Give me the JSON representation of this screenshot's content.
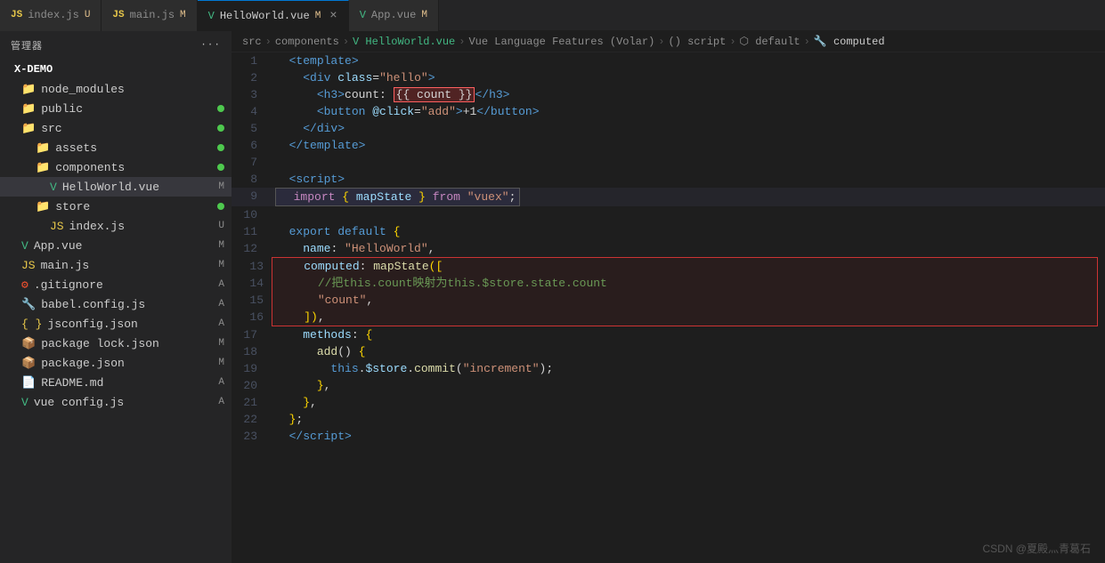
{
  "tabs": [
    {
      "id": "index",
      "label": "index.js",
      "type": "js",
      "badge": "U",
      "active": false
    },
    {
      "id": "main",
      "label": "main.js",
      "type": "js",
      "badge": "M",
      "active": false
    },
    {
      "id": "helloworld",
      "label": "HelloWorld.vue",
      "type": "vue",
      "badge": "M",
      "active": true
    },
    {
      "id": "appvue",
      "label": "App.vue",
      "type": "vue",
      "badge": "M",
      "active": false
    }
  ],
  "breadcrumb": {
    "items": [
      "src",
      "components",
      "HelloWorld.vue",
      "Vue Language Features (Volar)",
      "() script",
      "default",
      "computed"
    ]
  },
  "sidebar": {
    "header": "管理器",
    "project": "X-DEMO",
    "items": [
      {
        "name": "node_modules",
        "type": "folder",
        "badge": "",
        "dot": false,
        "indent": 1
      },
      {
        "name": "public",
        "type": "folder",
        "badge": "",
        "dot": true,
        "dotColor": "green",
        "indent": 1
      },
      {
        "name": "src",
        "type": "folder",
        "badge": "",
        "dot": true,
        "dotColor": "green",
        "indent": 1
      },
      {
        "name": "assets",
        "type": "folder",
        "badge": "",
        "dot": true,
        "dotColor": "green",
        "indent": 2
      },
      {
        "name": "components",
        "type": "folder",
        "badge": "",
        "dot": true,
        "dotColor": "green",
        "indent": 2
      },
      {
        "name": "HelloWorld.vue",
        "type": "vue",
        "badge": "M",
        "dot": false,
        "indent": 3,
        "active": true
      },
      {
        "name": "store",
        "type": "folder",
        "badge": "",
        "dot": true,
        "dotColor": "green",
        "indent": 2
      },
      {
        "name": "index.js",
        "type": "js",
        "badge": "U",
        "dot": false,
        "indent": 3
      },
      {
        "name": "App.vue",
        "type": "vue",
        "badge": "M",
        "dot": false,
        "indent": 1
      },
      {
        "name": "main.js",
        "type": "js",
        "badge": "M",
        "dot": false,
        "indent": 1
      },
      {
        "name": ".gitignore",
        "type": "git",
        "badge": "A",
        "dot": false,
        "indent": 1
      },
      {
        "name": "babel.config.js",
        "type": "babel",
        "badge": "A",
        "dot": false,
        "indent": 1
      },
      {
        "name": "jsconfig.json",
        "type": "json",
        "badge": "A",
        "dot": false,
        "indent": 1
      },
      {
        "name": "package-lock.json",
        "type": "pkg",
        "badge": "M",
        "dot": false,
        "indent": 1
      },
      {
        "name": "package.json",
        "type": "pkg",
        "badge": "M",
        "dot": false,
        "indent": 1
      },
      {
        "name": "README.md",
        "type": "md",
        "badge": "A",
        "dot": false,
        "indent": 1
      },
      {
        "name": "vue.config.js",
        "type": "js",
        "badge": "A",
        "dot": false,
        "indent": 1
      }
    ]
  },
  "watermark": "CSDN @夏殿灬青葛石"
}
